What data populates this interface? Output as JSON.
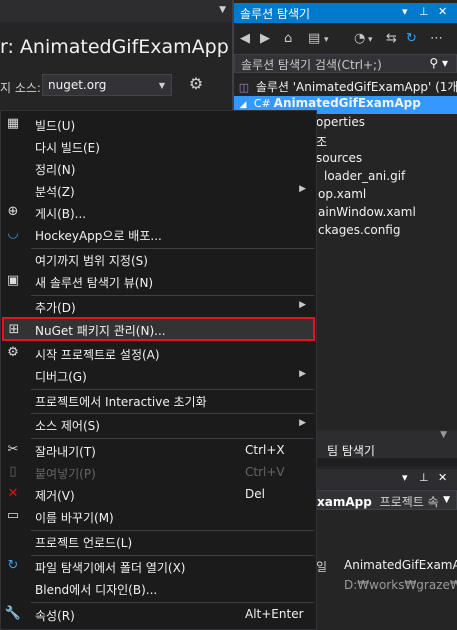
{
  "left": {
    "title": "r: AnimatedGifExamApp",
    "package_source_label": "지 소스:",
    "package_source_value": "nuget.org"
  },
  "solution_explorer": {
    "title": "솔루션 탐색기",
    "search_placeholder": "솔루션 탐색기 검색(Ctrl+;)",
    "tree": [
      "솔루션 'AnimatedGifExamApp' (1개",
      "AnimatedGifExamApp",
      "operties",
      "조",
      "sources",
      "loader_ani.gif",
      "op.xaml",
      "ainWindow.xaml",
      "ckages.config"
    ]
  },
  "tabs": {
    "team": "팀 탐색기"
  },
  "properties": {
    "object_name": "xamApp",
    "object_type": "프로젝트 속",
    "rows": [
      {
        "key": "일",
        "value": "AnimatedGifExamAp"
      },
      {
        "key": "",
        "value": "D:₩works₩graze₩P"
      }
    ]
  },
  "menu": {
    "items": [
      {
        "label": "빌드(U)",
        "icon": "build-icon"
      },
      {
        "label": "다시 빌드(E)"
      },
      {
        "label": "정리(N)"
      },
      {
        "label": "분석(Z)",
        "submenu": true
      },
      {
        "label": "게시(B)...",
        "icon": "globe-icon"
      },
      {
        "label": "HockeyApp으로 배포...",
        "icon": "hockeyapp-icon"
      },
      {
        "label": "여기까지 범위 지정(S)"
      },
      {
        "label": "새 솔루션 탐색기 뷰(N)",
        "icon": "new-view-icon"
      },
      {
        "label": "추가(D)",
        "submenu": true
      },
      {
        "label": "NuGet 패키지 관리(N)...",
        "icon": "nuget-package-icon",
        "highlight": true
      },
      {
        "label": "시작 프로젝트로 설정(A)",
        "icon": "gear-icon"
      },
      {
        "label": "디버그(G)",
        "submenu": true
      },
      {
        "label": "프로젝트에서 Interactive 초기화"
      },
      {
        "label": "소스 제어(S)",
        "submenu": true
      },
      {
        "label": "잘라내기(T)",
        "shortcut": "Ctrl+X",
        "icon": "scissors-icon"
      },
      {
        "label": "붙여넣기(P)",
        "shortcut": "Ctrl+V",
        "icon": "paste-icon",
        "disabled": true
      },
      {
        "label": "제거(V)",
        "shortcut": "Del",
        "icon": "remove-icon"
      },
      {
        "label": "이름 바꾸기(M)",
        "icon": "rename-icon"
      },
      {
        "label": "프로젝트 언로드(L)"
      },
      {
        "label": "파일 탐색기에서 폴더 열기(X)",
        "icon": "refresh-icon"
      },
      {
        "label": "Blend에서 디자인(B)..."
      },
      {
        "label": "속성(R)",
        "shortcut": "Alt+Enter",
        "icon": "wrench-icon"
      }
    ]
  },
  "colors": {
    "accent": "#007acc",
    "selected": "#3399ff",
    "highlight_border": "#e81123",
    "background": "#1e1e1e"
  }
}
